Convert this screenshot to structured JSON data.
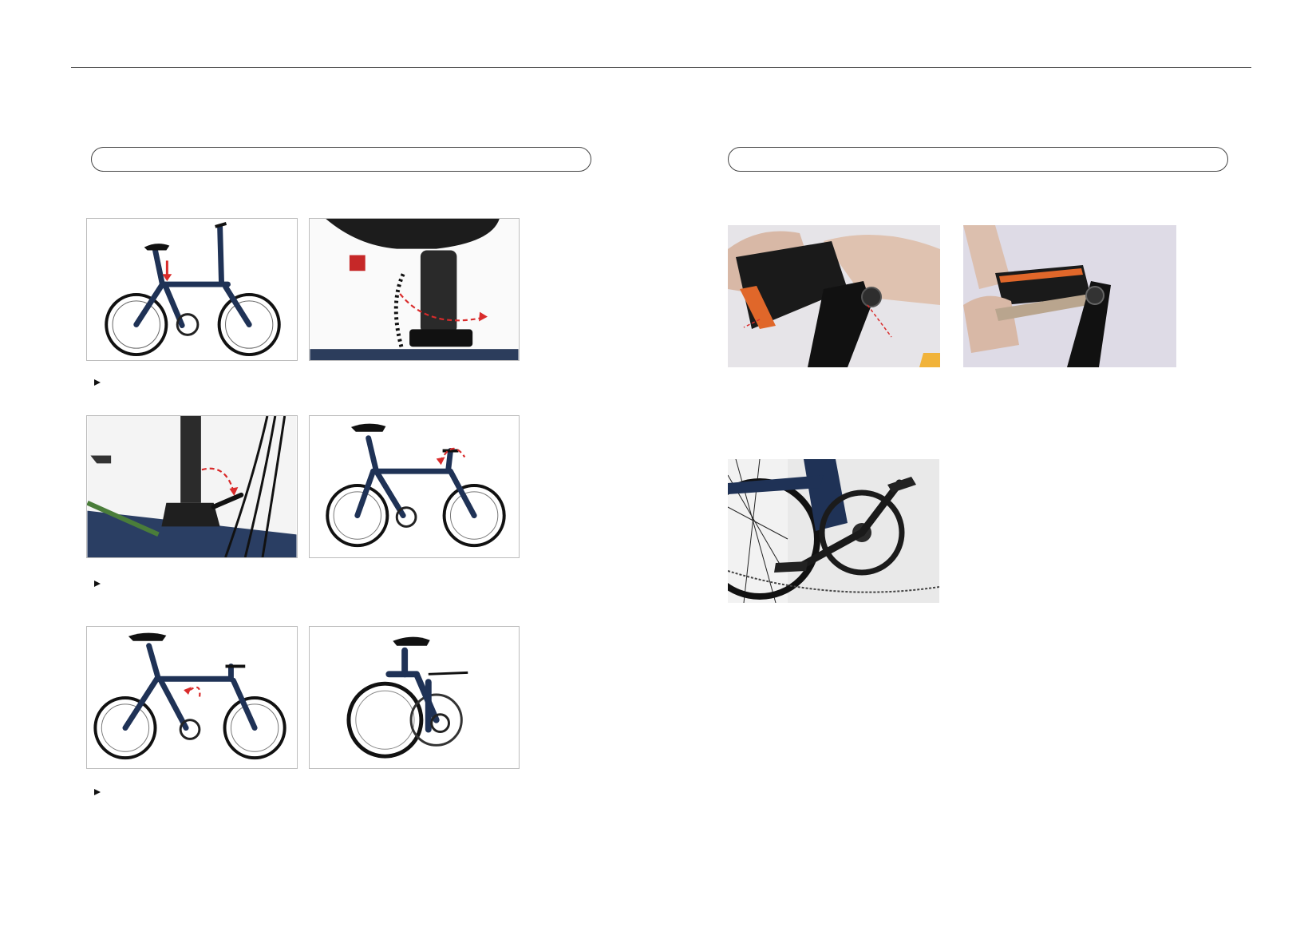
{
  "header": {
    "left_section_title": "",
    "right_section_title": ""
  },
  "left": {
    "steps": [
      {
        "caption": "",
        "photos": [
          "bike-side-view-with-seatpost-arrow",
          "seatpost-clamp-release-closeup"
        ]
      },
      {
        "caption": "",
        "photos": [
          "handlebar-stem-latch-closeup",
          "bike-with-handlebar-fold-arrow"
        ]
      },
      {
        "caption": "",
        "photos": [
          "bike-with-frame-hinge-arrow",
          "bike-fully-folded"
        ]
      }
    ]
  },
  "right": {
    "photos": [
      "pedal-thread-into-crank-arm",
      "wrench-tightening-pedal",
      "crankset-with-pedal-installed"
    ]
  },
  "colors": {
    "frame_blue": "#1f3256",
    "arrow_red": "#d92b2b",
    "pedal_orange": "#e0672a",
    "rule": "#555555"
  }
}
